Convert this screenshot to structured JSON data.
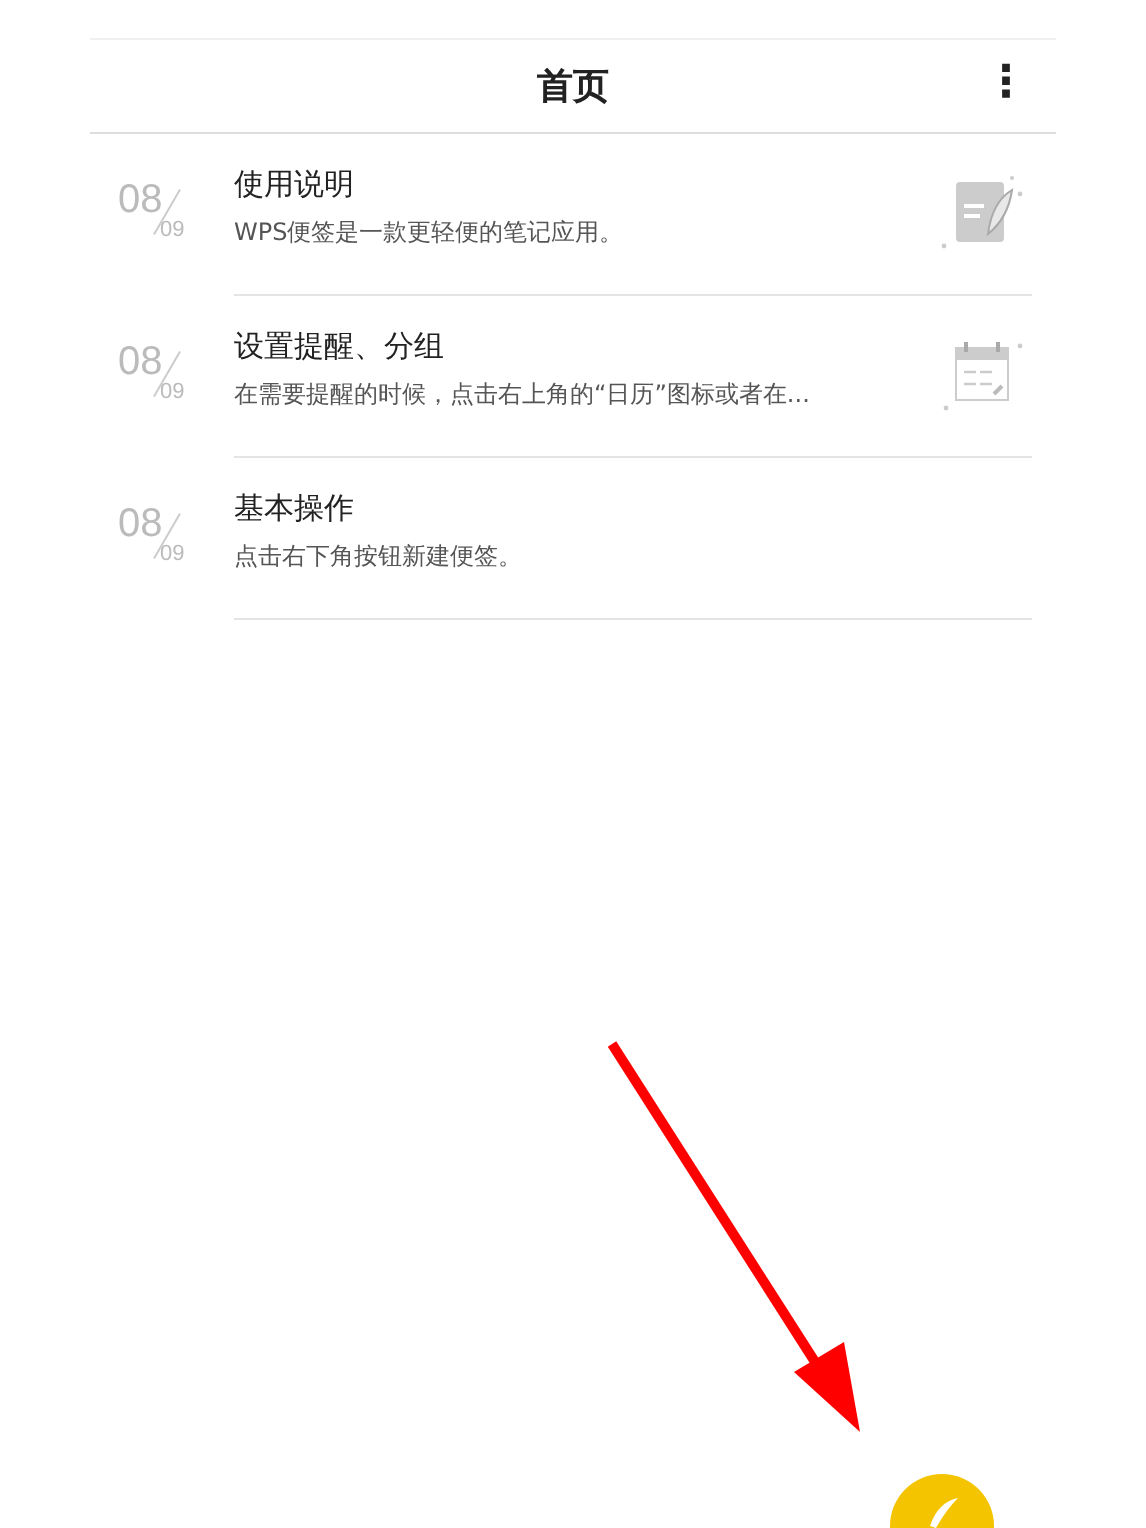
{
  "header": {
    "title": "首页",
    "menu_icon": "⋮"
  },
  "notes": [
    {
      "month": "08",
      "day": "09",
      "title": "使用说明",
      "preview": "WPS便签是一款更轻便的笔记应用。",
      "kind": "note"
    },
    {
      "month": "08",
      "day": "09",
      "title": "设置提醒、分组",
      "preview": "在需要提醒的时候，点击右上角的“日历”图标或者在...",
      "kind": "calendar"
    },
    {
      "month": "08",
      "day": "09",
      "title": "基本操作",
      "preview": "点击右下角按钮新建便签。",
      "kind": "plain"
    }
  ]
}
